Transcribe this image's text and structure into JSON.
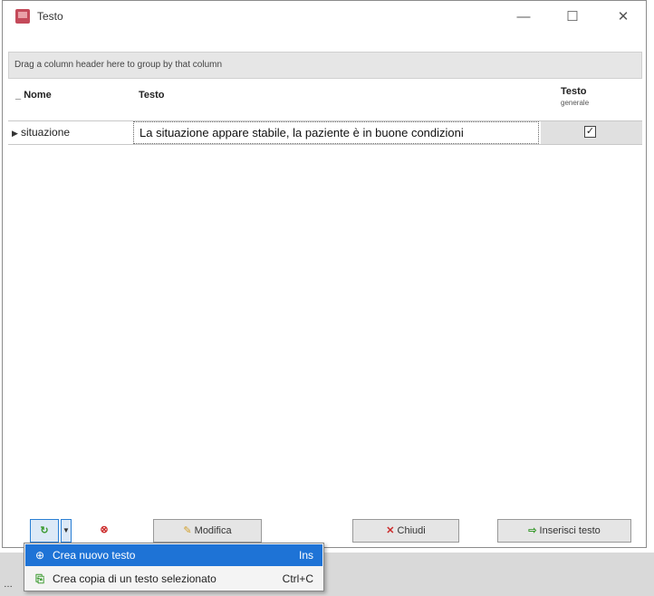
{
  "window": {
    "title": "Testo",
    "minimize_glyph": "—",
    "maximize_glyph": "☐",
    "close_glyph": "✕",
    "icon": "app-icon"
  },
  "grid": {
    "group_hint": "Drag a column header here to group by that column",
    "columns": [
      {
        "label": "Nome"
      },
      {
        "label": "Testo"
      },
      {
        "label": "Testo",
        "sub": "generale"
      }
    ],
    "rows": [
      {
        "nome": "situazione",
        "testo": "La situazione appare stabile, la paziente è in buone condizioni",
        "generale": true
      }
    ]
  },
  "toolbar": {
    "new_icon": "new-document-icon",
    "dropdown_glyph": "▼",
    "delete_icon": "delete-icon",
    "modifica_label": "Modifica",
    "chiudi_label": "Chiudi",
    "inserisci_label": "Inserisci testo"
  },
  "menu": {
    "items": [
      {
        "label": "Crea nuovo testo",
        "shortcut": "Ins",
        "icon": "new-document-icon"
      },
      {
        "label": "Crea copia di un testo selezionato",
        "shortcut": "Ctrl+C",
        "icon": "copy-icon"
      }
    ]
  },
  "colors": {
    "selection": "#1e73d6",
    "accent_green": "#3a9a2e",
    "accent_red": "#cc2a2a"
  }
}
